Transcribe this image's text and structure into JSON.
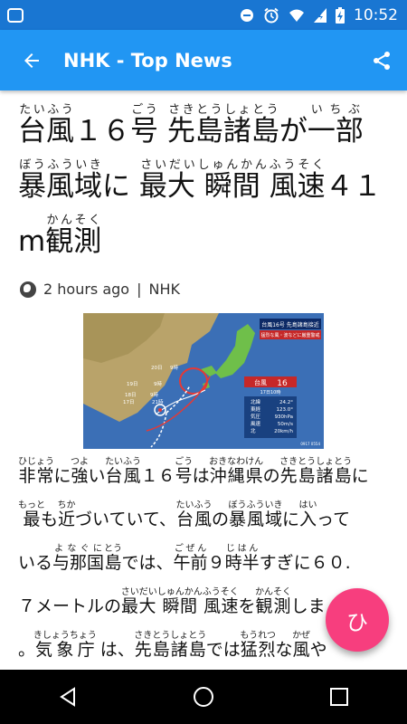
{
  "status": {
    "time": "10:52"
  },
  "appbar": {
    "title": "NHK - Top News"
  },
  "headline": {
    "line1": [
      {
        "base": "台風",
        "rt": "たいふう"
      },
      {
        "base": "１６",
        "rt": ""
      },
      {
        "base": "号",
        "rt": "ごう"
      },
      {
        "base": " ",
        "rt": ""
      },
      {
        "base": "先島諸島",
        "rt": "さきとうしょとう"
      },
      {
        "base": "が",
        "rt": ""
      },
      {
        "base": "一部",
        "rt": "いちぶ"
      }
    ],
    "line2": [
      {
        "base": "暴風域",
        "rt": "ぼうふういき"
      },
      {
        "base": "に ",
        "rt": ""
      },
      {
        "base": "最大 瞬間 風速",
        "rt": "さいだいしゅんかんふうそく"
      },
      {
        "base": "４１",
        "rt": ""
      }
    ],
    "line3": [
      {
        "base": "m",
        "rt": ""
      },
      {
        "base": "観測",
        "rt": "かんそく"
      }
    ]
  },
  "meta": {
    "time_ago": "2 hours ago",
    "separator": "|",
    "source": "NHK"
  },
  "photo": {
    "caption_title": "台風16号 先島諸島接近",
    "caption_warn": "猛烈な風・波などに厳重警戒",
    "typhoon_label": "台風",
    "typhoon_number": "16",
    "typhoon_time": "17日10時",
    "stats": [
      {
        "label": "北緯",
        "value": "24.2°"
      },
      {
        "label": "東経",
        "value": "123.0°"
      },
      {
        "label": "気圧",
        "value": "930hPa"
      },
      {
        "label": "風速",
        "value": "50m/s"
      },
      {
        "label": "北",
        "value": "20km/h"
      }
    ],
    "track_labels": [
      "20日",
      "9時",
      "19日",
      "9時",
      "18日",
      "9時",
      "17日",
      "21時"
    ],
    "credit": "0917 0554"
  },
  "body": {
    "lines": [
      [
        {
          "base": "非常",
          "rt": "ひじょう"
        },
        {
          "base": "に",
          "rt": ""
        },
        {
          "base": "強",
          "rt": "つよ"
        },
        {
          "base": "い",
          "rt": ""
        },
        {
          "base": "台風",
          "rt": "たいふう"
        },
        {
          "base": "１６",
          "rt": ""
        },
        {
          "base": "号",
          "rt": "ごう"
        },
        {
          "base": "は",
          "rt": ""
        },
        {
          "base": "沖縄県",
          "rt": "おきなわけん"
        },
        {
          "base": "の",
          "rt": ""
        },
        {
          "base": "先島諸島",
          "rt": "さきとうしょとう"
        },
        {
          "base": "に",
          "rt": ""
        }
      ],
      [
        {
          "base": "最",
          "rt": "もっと"
        },
        {
          "base": "も",
          "rt": ""
        },
        {
          "base": "近",
          "rt": "ちか"
        },
        {
          "base": "づいていて、",
          "rt": ""
        },
        {
          "base": "台風",
          "rt": "たいふう"
        },
        {
          "base": "の",
          "rt": ""
        },
        {
          "base": "暴風域",
          "rt": "ぼうふういき"
        },
        {
          "base": "に",
          "rt": ""
        },
        {
          "base": "入",
          "rt": "はい"
        },
        {
          "base": "って",
          "rt": ""
        }
      ],
      [
        {
          "base": "いる",
          "rt": ""
        },
        {
          "base": "与那国",
          "rt": "よなぐに"
        },
        {
          "base": "島",
          "rt": "とう"
        },
        {
          "base": "では、",
          "rt": ""
        },
        {
          "base": "午前",
          "rt": "ごぜん"
        },
        {
          "base": "９",
          "rt": ""
        },
        {
          "base": "時半",
          "rt": "じはん"
        },
        {
          "base": "すぎに６０.",
          "rt": ""
        }
      ],
      [
        {
          "base": "７メートルの",
          "rt": ""
        },
        {
          "base": "最大 瞬間 風速",
          "rt": "さいだいしゅんかんふうそく"
        },
        {
          "base": "を",
          "rt": ""
        },
        {
          "base": "観測",
          "rt": "かんそく"
        },
        {
          "base": "しま",
          "rt": ""
        }
      ],
      [
        {
          "base": "。",
          "rt": ""
        },
        {
          "base": "気象庁",
          "rt": "きしょうちょう"
        },
        {
          "base": " は、",
          "rt": ""
        },
        {
          "base": "先島諸島",
          "rt": "さきとうしょとう"
        },
        {
          "base": "では",
          "rt": ""
        },
        {
          "base": "猛烈",
          "rt": "もうれつ"
        },
        {
          "base": "な",
          "rt": ""
        },
        {
          "base": "風",
          "rt": "かぜ"
        },
        {
          "base": "や",
          "rt": ""
        }
      ]
    ]
  },
  "fab": {
    "label": "ひ"
  },
  "colors": {
    "appbar": "#2196f3",
    "statusbar": "#1976d2",
    "fab": "#f73e7e"
  }
}
